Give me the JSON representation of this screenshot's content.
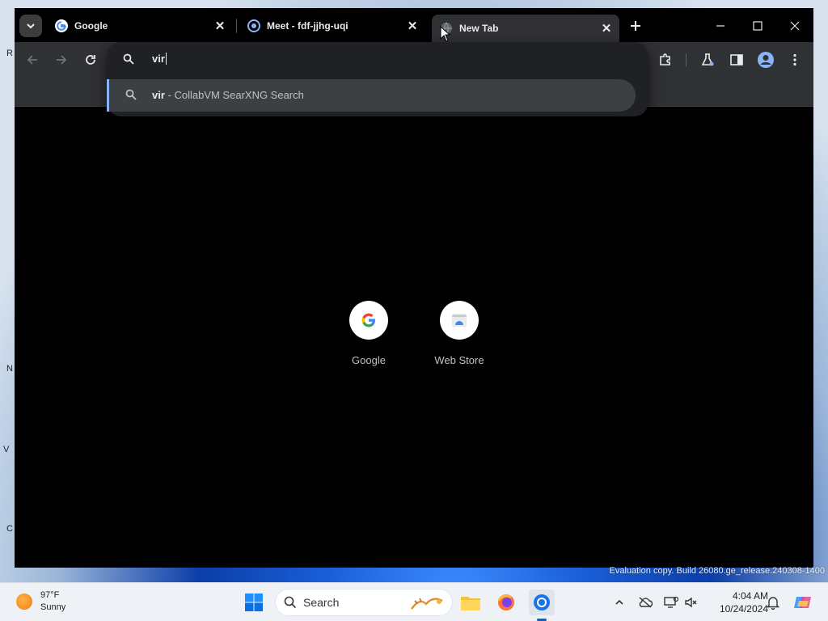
{
  "browser": {
    "tabs": [
      {
        "title": "Google",
        "favicon": "google-g-icon"
      },
      {
        "title": "Meet - fdf-jjhg-uqi",
        "favicon": "meet-icon"
      },
      {
        "title": "New Tab",
        "favicon": "loading-globe-icon",
        "active": true
      }
    ],
    "omnibox": {
      "input_value": "vir",
      "suggestion": {
        "query": "vir",
        "separator": " - ",
        "engine": "CollabVM SearXNG Search"
      }
    },
    "shortcuts": [
      {
        "label": "Google",
        "icon": "google-g-icon"
      },
      {
        "label": "Web Store",
        "icon": "web-store-icon"
      }
    ]
  },
  "desktop": {
    "watermark": "Evaluation copy. Build 26080.ge_release.240308-1400"
  },
  "taskbar": {
    "weather": {
      "temp": "97°F",
      "condition": "Sunny"
    },
    "search_placeholder": "Search",
    "clock": {
      "time": "4:04 AM",
      "date": "10/24/2024"
    }
  },
  "colors": {
    "accent": "#8ab4f8",
    "toolbar": "#303134",
    "popup": "#202124",
    "taskbar": "#eef1f5"
  }
}
